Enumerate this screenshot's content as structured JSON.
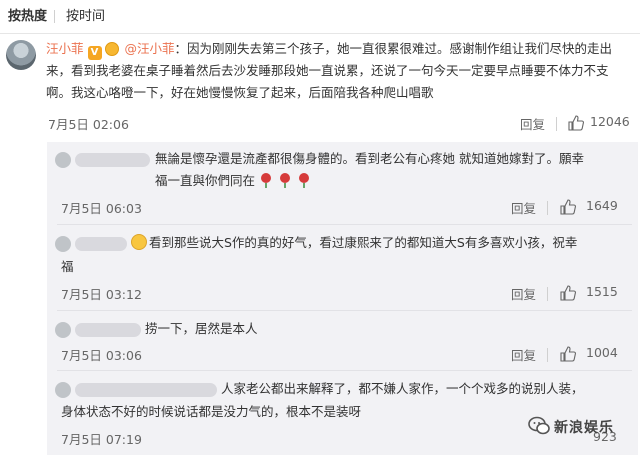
{
  "tabs": {
    "hot": "按热度",
    "time": "按时间"
  },
  "main_comment": {
    "username": "汪小菲",
    "verified_badge": "V",
    "mention": "@汪小菲",
    "separator": "：",
    "text": "因为刚刚失去第三个孩子，她一直很累很难过。感谢制作组让我们尽快的走出来，看到我老婆在桌子睡着然后去沙发睡那段她一直说累，还说了一句今天一定要早点睡要不体力不支啊。我这心咯噔一下，好在她慢慢恢复了起来，后面陪我各种爬山唱歌",
    "time": "7月5日 02:06",
    "reply_label": "回复",
    "likes": "12046"
  },
  "replies": [
    {
      "text_line1": "無論是懷孕還是流產都很傷身體的。看到老公有心疼她 就知道她嫁對了。願幸",
      "text_line2": "福一直與你們同在",
      "time": "7月5日 06:03",
      "reply_label": "回复",
      "likes": "1649",
      "emoji": "rose"
    },
    {
      "text_line1": "看到那些说大S作的真的好气，看过康熙来了的都知道大S有多喜欢小孩，祝幸",
      "text_line2": "福",
      "time": "7月5日 03:12",
      "reply_label": "回复",
      "likes": "1515",
      "emoji": "smiley"
    },
    {
      "text_line1": "捞一下，居然是本人",
      "time": "7月5日 03:06",
      "reply_label": "回复",
      "likes": "1004"
    },
    {
      "text_line1": "人家老公都出来解释了，都不嫌人家作，一个个戏多的说别人装，",
      "text_line2": "身体状态不好的时候说话都是没力气的，根本不是装呀",
      "time": "7月5日 07:19",
      "reply_label": "回复",
      "likes": "923"
    }
  ],
  "watermark": {
    "text": "新浪娱乐",
    "icon": "wechat-icon"
  },
  "colors": {
    "username": "#eb7350",
    "reply_bg": "#f2f2f5"
  }
}
